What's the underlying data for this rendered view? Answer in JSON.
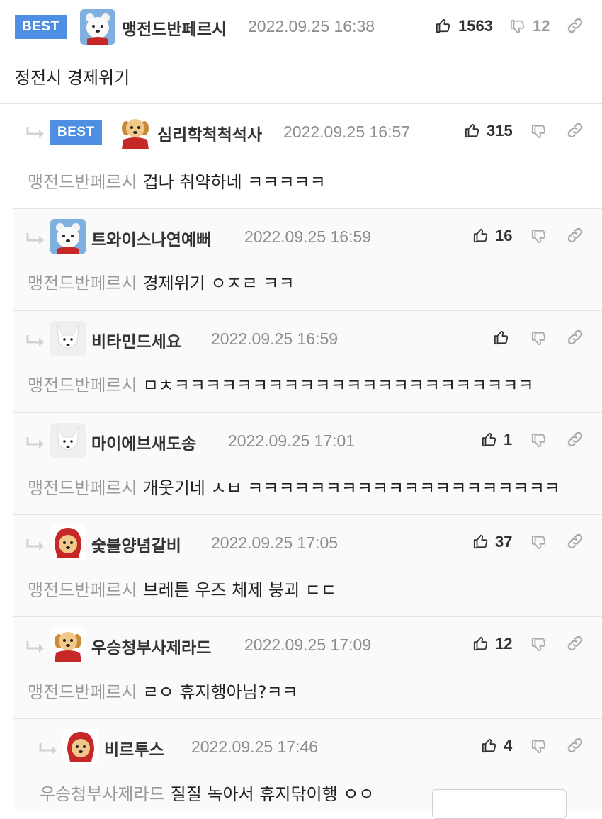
{
  "colors": {
    "best_bg": "#4e8fe3",
    "muted": "#8d8d8d",
    "mention": "#9a9a9a"
  },
  "post": {
    "best_label": "BEST",
    "nickname": "맹전드반페르시",
    "date": "2022.09.25 16:38",
    "upvotes": "1563",
    "downvotes": "12",
    "text": "정전시 경제위기",
    "avatar": "polar-bear-avatar"
  },
  "comments": [
    {
      "best_label": "BEST",
      "nickname": "심리학척척석사",
      "date": "2022.09.25 16:57",
      "upvotes": "315",
      "mention": "맹전드반페르시",
      "text": "겁나 취약하네 ㅋㅋㅋㅋㅋ",
      "avatar": "puppy-cape-avatar"
    },
    {
      "nickname": "트와이스나연예뻐",
      "date": "2022.09.25 16:59",
      "upvotes": "16",
      "mention": "맹전드반페르시",
      "text": "경제위기 ㅇㅈㄹ ㅋㅋ",
      "avatar": "polar-bear-avatar"
    },
    {
      "nickname": "비타민드세요",
      "date": "2022.09.25 16:59",
      "upvotes": "",
      "mention": "맹전드반페르시",
      "text": "ㅁㅊㅋㅋㅋㅋㅋㅋㅋㅋㅋㅋㅋㅋㅋㅋㅋㅋㅋㅋㅋㅋㅋㅋㅋ",
      "avatar": "white-fox-avatar"
    },
    {
      "nickname": "마이에브새도송",
      "date": "2022.09.25 17:01",
      "upvotes": "1",
      "mention": "맹전드반페르시",
      "text": "개웃기네 ㅅㅂ ㅋㅋㅋㅋㅋㅋㅋㅋㅋㅋㅋㅋㅋㅋㅋㅋㅋㅋㅋㅋ",
      "avatar": "white-fox-avatar"
    },
    {
      "nickname": "숯불양념갈비",
      "date": "2022.09.25 17:05",
      "upvotes": "37",
      "mention": "맹전드반페르시",
      "text": "브레튼 우즈 체제 붕괴 ㄷㄷ",
      "avatar": "puppy-hood-avatar"
    },
    {
      "nickname": "우승청부사제라드",
      "date": "2022.09.25 17:09",
      "upvotes": "12",
      "mention": "맹전드반페르시",
      "text": "ㄹㅇ 휴지행아님?ㅋㅋ",
      "avatar": "puppy-cape-avatar"
    },
    {
      "nickname": "비르투스",
      "date": "2022.09.25 17:46",
      "upvotes": "4",
      "mention": "우승청부사제라드",
      "text": "질질 녹아서 휴지닦이행 ㅇㅇ",
      "avatar": "puppy-hood-avatar"
    }
  ],
  "icons": {
    "up": "thumbs-up-icon",
    "down": "thumbs-down-icon",
    "link": "link-icon",
    "reply": "reply-arrow-icon"
  }
}
